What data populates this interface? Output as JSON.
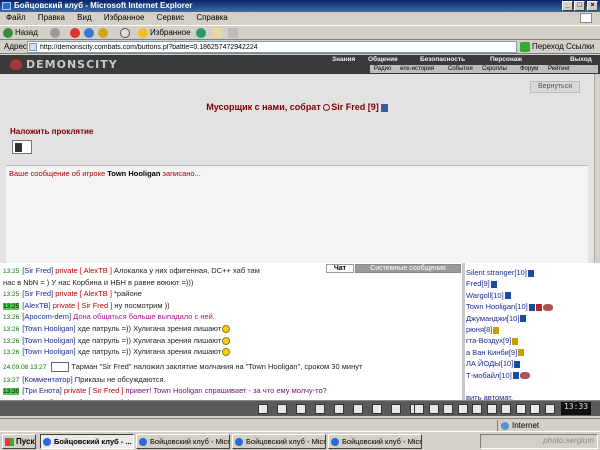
{
  "window": {
    "title": "Бойцовский клуб - Microsoft Internet Explorer",
    "controls": [
      "_",
      "□",
      "×"
    ]
  },
  "menu": [
    "Файл",
    "Правка",
    "Вид",
    "Избранное",
    "Сервис",
    "Справка"
  ],
  "toolbar": {
    "back": "Назад",
    "favorites": "Избранное"
  },
  "address": {
    "label": "Адрес:",
    "url": "http://demonscity.combats.com/buttons.pl?battle=0.186257472942224",
    "go": "Переход",
    "links": "Ссылки"
  },
  "game": {
    "logo": "DEMONSCITY",
    "topnav": [
      "Знания",
      "Общение",
      "Безопасность",
      "Персонаж",
      "Выход"
    ],
    "subnav": [
      "Радио",
      "enx-история",
      "События",
      "Скроллы",
      "Форум",
      "Рейтинг"
    ],
    "back_button": "Вернуться",
    "announcement": {
      "text": "Мусорщик с нами, собрат",
      "name": "Sir Fred",
      "level": "[9]"
    },
    "curse_title": "Наложить проклятие",
    "message": {
      "prefix": "Ваше сообщение об игроке",
      "name": "Town Hooligan",
      "suffix": "записано..."
    }
  },
  "chat_tabs": {
    "chat": "Чат",
    "system": "Системные сообщения"
  },
  "chat": [
    {
      "time": "13:25",
      "hl": false,
      "nick": "[Sir Fred]",
      "priv": "private [ AlexTB ]",
      "text": "Алокалка у них офигенная, DC++ хаб там",
      "cls": "dark"
    },
    {
      "time": "",
      "hl": false,
      "nick": "",
      "priv": "",
      "text": "нас в NbN = ) У нас Корбина и НБН в равне воюют =)))",
      "cls": "dark"
    },
    {
      "time": "13:25",
      "hl": false,
      "nick": "[Sir Fred]",
      "priv": "private [ AlexTB ]",
      "text": "*районе",
      "cls": "dark"
    },
    {
      "time": "13:25",
      "hl": true,
      "nick": "[AlexTB]",
      "priv": "private [ Sir Fred ]",
      "text": "ну посмотрим ))",
      "cls": "dark"
    },
    {
      "time": "13:26",
      "hl": false,
      "nick": "[Apocom-dem]",
      "priv": "",
      "text": "Дона общаться больше выпадало с ней.",
      "cls": "magenta"
    },
    {
      "time": "13:26",
      "hl": false,
      "nick": "[Town Hooligan]",
      "priv": "",
      "text": "хде патруль =)) Хулигана зрения лишают",
      "cls": "dark",
      "smile": true
    },
    {
      "time": "13:26",
      "hl": false,
      "nick": "[Town Hooligan]",
      "priv": "",
      "text": "хде патруль =)) Хулигана зрения лишают",
      "cls": "dark",
      "smile": true
    },
    {
      "time": "13:26",
      "hl": false,
      "nick": "[Town Hooligan]",
      "priv": "",
      "text": "хде патруль =)) Хулигана зрения лишают",
      "cls": "dark",
      "smile": true
    }
  ],
  "chat_system": {
    "datetime": "24.09.08 13:27",
    "text": "Тарман \"Sir Fred\" наложил заклятие молчания на \"Town Hooligan\", сроком 30 минут"
  },
  "chat_tail": [
    {
      "time": "13:27",
      "hl": false,
      "nick": "[Комментатор]",
      "priv": "",
      "text": "Приказы не обсуждаются.",
      "cls": "dark"
    },
    {
      "time": "13:30",
      "hl": true,
      "nick": "[Три Енота]",
      "priv": "private [ Sir Fred ]",
      "text": "привет! Town Hooligan спрашивает - за что ему молчу-то?",
      "cls": "greentxt"
    },
    {
      "time": "13:31",
      "hl": false,
      "nick": "[Sir Fred]",
      "priv": "private [ Три Енота ]",
      "text": "флуд цп",
      "cls": "dark"
    }
  ],
  "users": [
    {
      "name": "Silent stranger",
      "level": "[10]",
      "badges": [
        "blue"
      ]
    },
    {
      "name": "Fred",
      "level": "[9]",
      "badges": [
        "blue"
      ]
    },
    {
      "name": "Wargoll",
      "level": "[10]",
      "badges": [
        "blue"
      ]
    },
    {
      "name": "Town Hooligan",
      "level": "[10]",
      "badges": [
        "blue",
        "red"
      ],
      "ext": true
    },
    {
      "name": "Джуманджи",
      "level": "[10]",
      "badges": [
        "blue"
      ]
    },
    {
      "name": "рюня",
      "level": "[8]",
      "badges": [
        "gold"
      ]
    },
    {
      "name": "гта-Воздух",
      "level": "[9]",
      "badges": [
        "gold"
      ]
    },
    {
      "name": "а Ван Кинби",
      "level": "[9]",
      "badges": [
        "gold"
      ]
    },
    {
      "name": "ЛА ЙОДЫ",
      "level": "[10]",
      "badges": [
        "blue"
      ]
    },
    {
      "name": "Т-мобайл",
      "level": "[10]",
      "badges": [
        "blue"
      ],
      "ext": true
    },
    {
      "name": "",
      "level": "",
      "badges": []
    },
    {
      "name": "вить автомат.",
      "level": "",
      "badges": []
    }
  ],
  "clock": "13:33",
  "status": {
    "zone": "Internet"
  },
  "taskbar": {
    "start": "Пуск",
    "tasks": [
      "Бойцовский клуб - ...",
      "Бойцовский клуб - Micro...",
      "Бойцовский клуб - Micro...",
      "Бойцовский клуб - Micro..."
    ],
    "watermark": "photo.sergium"
  }
}
